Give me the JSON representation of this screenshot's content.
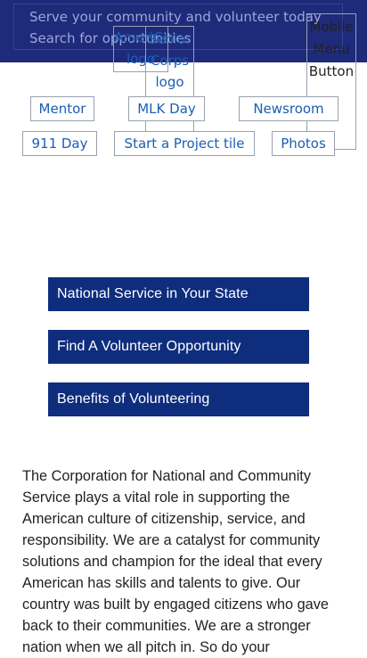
{
  "header": {
    "tagline": "Serve your community and volunteer today",
    "search_prompt": "Search for opportunities"
  },
  "logos": {
    "americorps_alt": "AmeriCorps logo",
    "seniorcorps_alt": "Senior Corps logo"
  },
  "mobile_menu_label": "Mobile Menu Button",
  "tiles": {
    "mentor": "Mentor",
    "mlk_day": "MLK Day",
    "newsroom": "Newsroom",
    "day_911": "911 Day",
    "start_project": "Start a Project tile",
    "photos": "Photos"
  },
  "nav_buttons": {
    "state_service": "National Service in Your State",
    "find_opportunity": "Find A Volunteer Opportunity",
    "benefits": "Benefits of Volunteering"
  },
  "about_text": "The Corporation for National and Community Service plays a vital role in supporting the American culture of citizenship, service, and responsibility. We are a catalyst for community solutions and champion for the ideal that every American has skills and talents to give. Our country was built by engaged citizens who gave back to their communities. We are a stronger nation when we all pitch in. So do your",
  "colors": {
    "header_bg": "#1e2a7a",
    "nav_button_bg": "#0f2d7d",
    "link_text": "#1a5fb4"
  }
}
